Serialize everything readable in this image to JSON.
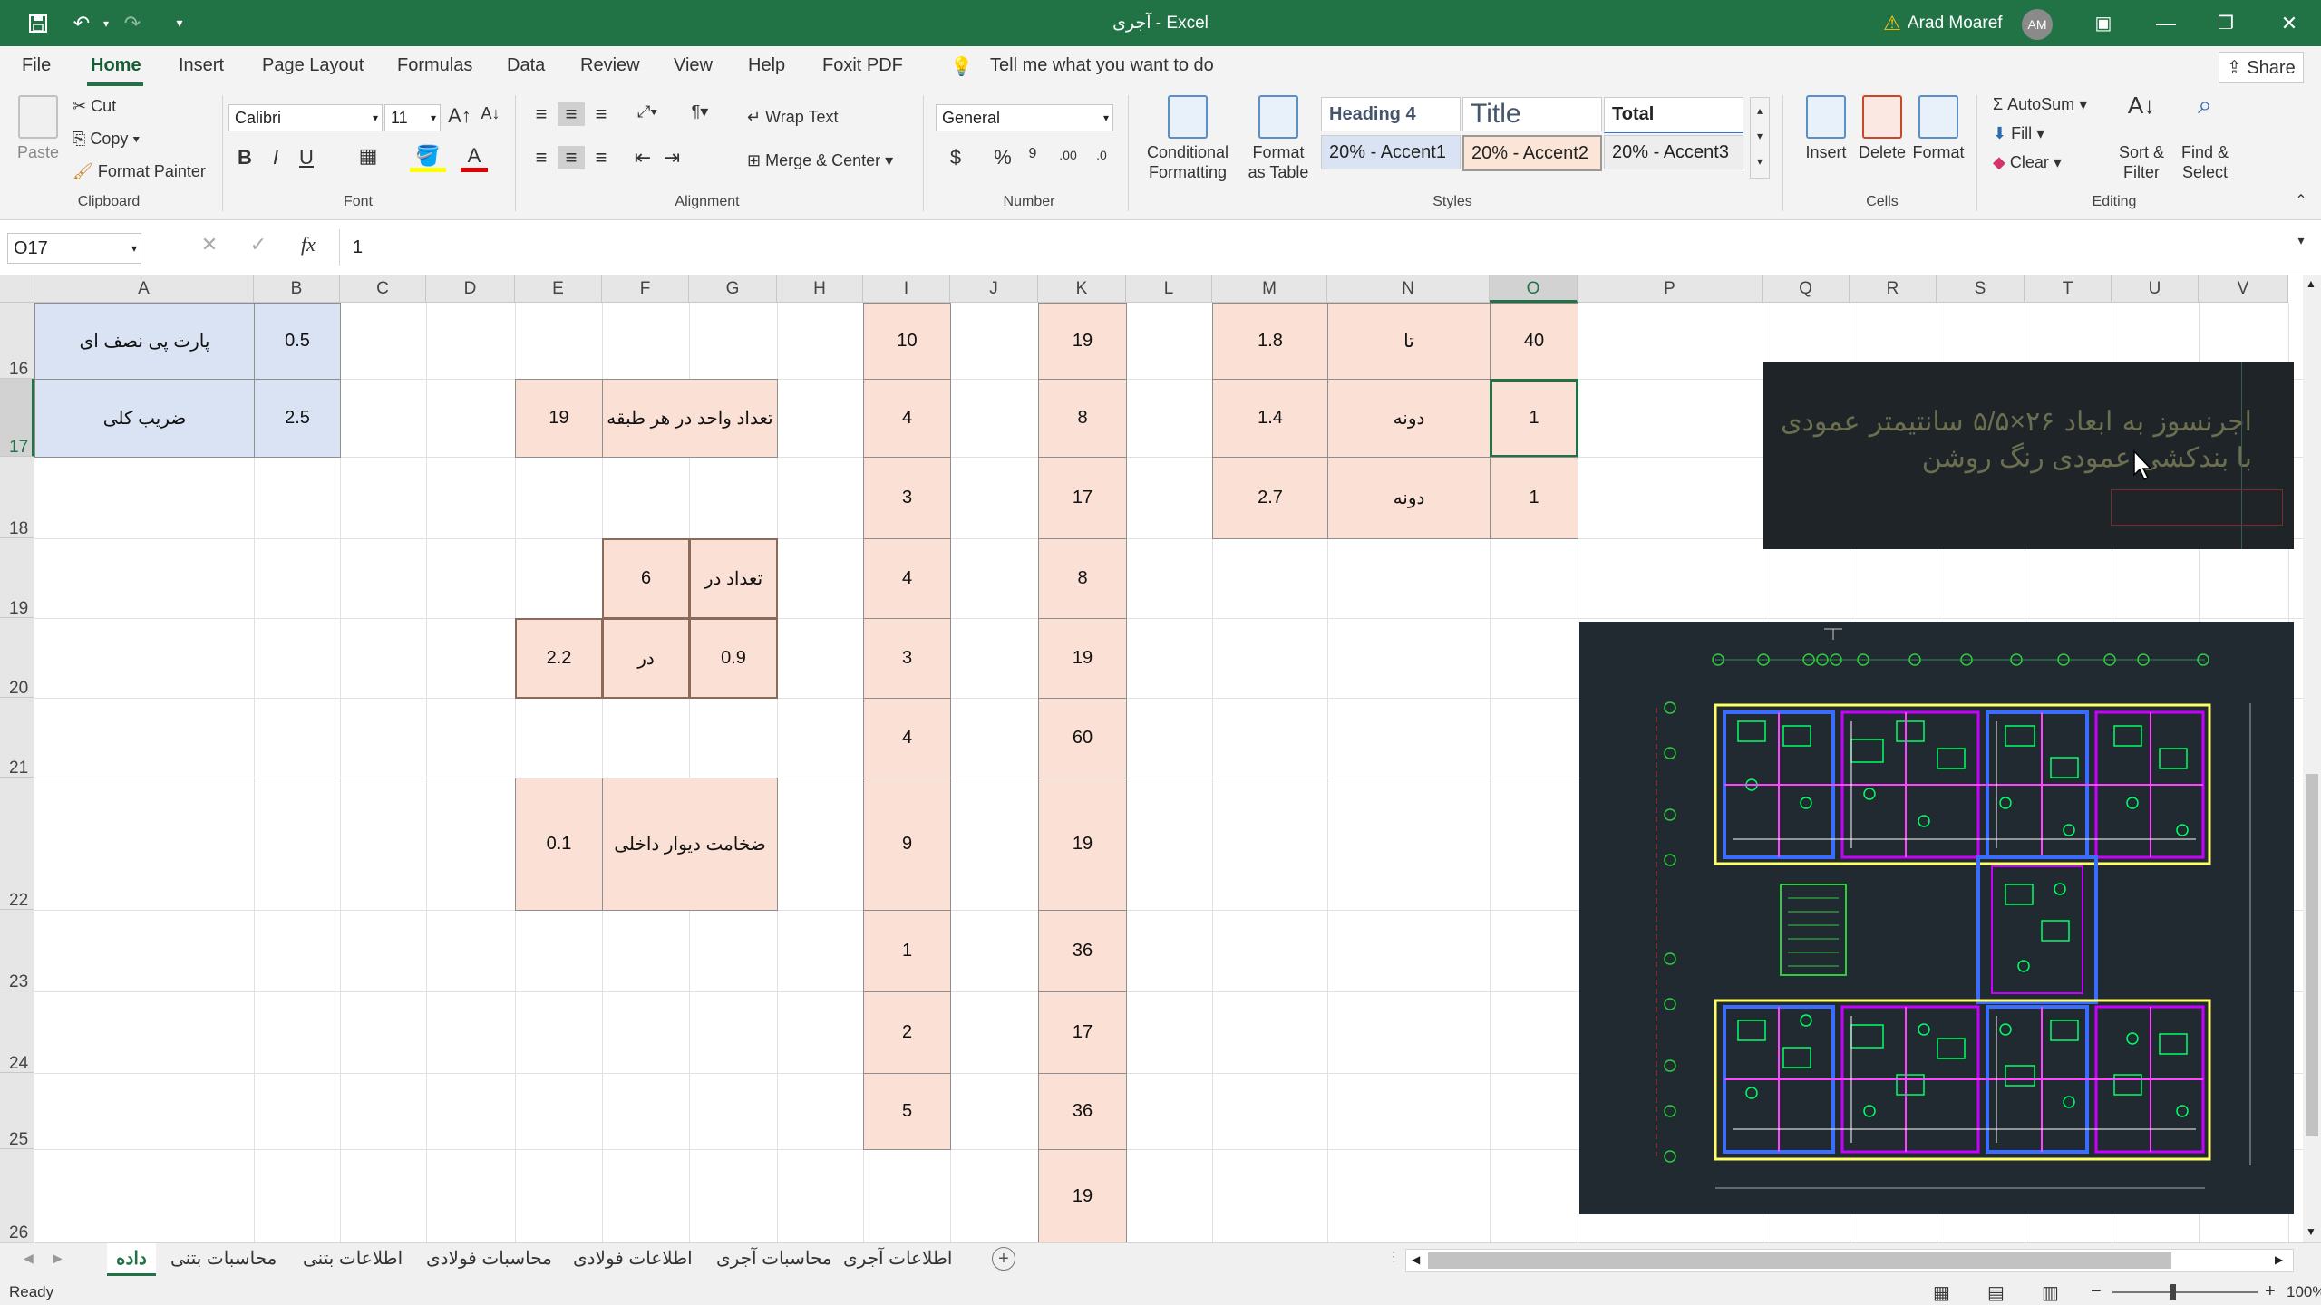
{
  "window": {
    "title": "آجری - Excel",
    "warning_icon": "warning-icon",
    "user_name": "Arad Moaref",
    "user_initials": "AM"
  },
  "quick_access": {
    "save": "save-icon",
    "undo": "undo-icon",
    "redo": "redo-icon",
    "customize": "chevron-down-icon"
  },
  "menu": {
    "tabs": [
      "File",
      "Home",
      "Insert",
      "Page Layout",
      "Formulas",
      "Data",
      "Review",
      "View",
      "Help",
      "Foxit PDF"
    ],
    "active": "Home",
    "tell_me": "Tell me what you want to do",
    "share": "Share"
  },
  "ribbon": {
    "clipboard": {
      "label": "Clipboard",
      "paste": "Paste",
      "cut": "Cut",
      "copy": "Copy",
      "format_painter": "Format Painter"
    },
    "font": {
      "label": "Font",
      "name": "Calibri",
      "size": "11",
      "bold": "B",
      "italic": "I",
      "underline": "U"
    },
    "alignment": {
      "label": "Alignment",
      "wrap_text": "Wrap Text",
      "merge_center": "Merge & Center"
    },
    "number": {
      "label": "Number",
      "format": "General",
      "currency": "$",
      "percent": "%",
      "comma": "9",
      "inc_dec": ".00",
      "dec_dec": ".0"
    },
    "styles": {
      "label": "Styles",
      "conditional": "Conditional Formatting",
      "format_table": "Format as Table",
      "cells": [
        "Heading 4",
        "Title",
        "Total",
        "20% - Accent1",
        "20% - Accent2",
        "20% - Accent3"
      ]
    },
    "cells": {
      "label": "Cells",
      "insert": "Insert",
      "delete": "Delete",
      "format": "Format"
    },
    "editing": {
      "label": "Editing",
      "autosum": "AutoSum",
      "fill": "Fill",
      "clear": "Clear",
      "sort_filter": "Sort & Filter",
      "find_select": "Find & Select"
    }
  },
  "formula_bar": {
    "name_box": "O17",
    "fx": "fx",
    "value": "1"
  },
  "columns": [
    "A",
    "B",
    "C",
    "D",
    "E",
    "F",
    "G",
    "H",
    "I",
    "J",
    "K",
    "L",
    "M",
    "N",
    "O",
    "P",
    "Q",
    "R",
    "S",
    "T",
    "U",
    "V"
  ],
  "rows": [
    "16",
    "17",
    "18",
    "19",
    "20",
    "21",
    "22",
    "23",
    "24",
    "25",
    "26"
  ],
  "cells": {
    "A16": "پارت پی نصف ای",
    "B16": "0.5",
    "A17": "ضریب کلی",
    "B17": "2.5",
    "E17": "19",
    "F17": "تعداد واحد در هر طبقه",
    "F19": "6",
    "G19": "تعداد در",
    "E20": "2.2",
    "F20": "در",
    "G20": "0.9",
    "E22": "0.1",
    "F22": "ضخامت دیوار داخلی",
    "I": [
      "10",
      "4",
      "3",
      "4",
      "3",
      "4",
      "9",
      "1",
      "2",
      "5"
    ],
    "K": [
      "19",
      "8",
      "17",
      "8",
      "19",
      "60",
      "19",
      "36",
      "17",
      "36",
      "19"
    ],
    "M16": "1.8",
    "N16": "تا",
    "O16": "40",
    "M17": "1.4",
    "N17": "دونه",
    "O17": "1",
    "M18": "2.7",
    "N18": "دونه",
    "O18": "1"
  },
  "textbox": {
    "text": "اجرنسوز به ابعاد ۲۶×۵/۵ سانتیمتر عمودی با بندکشی عمودی رنگ روشن"
  },
  "sheets": [
    "داده",
    "محاسبات بتنی",
    "اطلاعات بتنی",
    "محاسبات فولادی",
    "اطلاعات فولادی",
    "محاسبات آجری",
    "اطلاعات آجری"
  ],
  "active_sheet": "داده",
  "status": {
    "ready": "Ready",
    "zoom": "100%"
  }
}
